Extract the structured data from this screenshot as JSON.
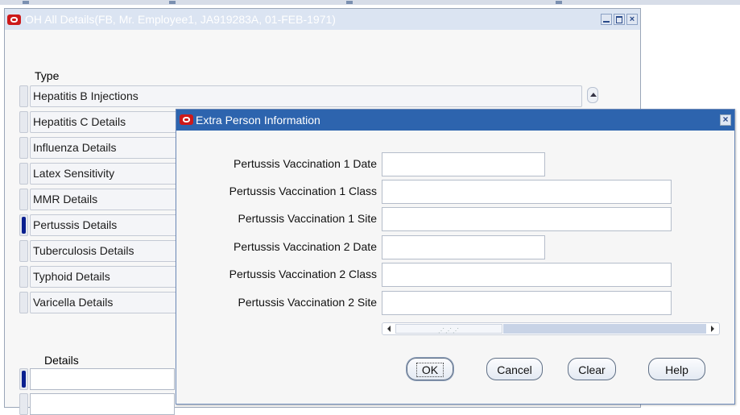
{
  "main_window": {
    "title": "OH All Details(FB, Mr. Employee1, JA919283A, 01-FEB-1971)",
    "type_label": "Type",
    "types": [
      {
        "label": "Hepatitis B Injections",
        "selected": false
      },
      {
        "label": "Hepatitis C Details",
        "selected": false
      },
      {
        "label": "Influenza Details",
        "selected": false
      },
      {
        "label": "Latex Sensitivity",
        "selected": false
      },
      {
        "label": "MMR Details",
        "selected": false
      },
      {
        "label": "Pertussis Details",
        "selected": true
      },
      {
        "label": "Tuberculosis Details",
        "selected": false
      },
      {
        "label": "Typhoid Details",
        "selected": false
      },
      {
        "label": "Varicella Details",
        "selected": false
      }
    ],
    "details_label": "Details"
  },
  "dialog": {
    "title": "Extra Person Information",
    "fields": [
      {
        "label": "Pertussis Vaccination 1 Date",
        "value": ""
      },
      {
        "label": "Pertussis Vaccination 1 Class",
        "value": ""
      },
      {
        "label": "Pertussis Vaccination 1 Site",
        "value": ""
      },
      {
        "label": "Pertussis Vaccination 2 Date",
        "value": ""
      },
      {
        "label": "Pertussis Vaccination 2 Class",
        "value": ""
      },
      {
        "label": "Pertussis Vaccination 2 Site",
        "value": ""
      }
    ],
    "buttons": {
      "ok": {
        "label": "OK"
      },
      "cancel": {
        "label": "Cancel"
      },
      "clear": {
        "label": "Clear"
      },
      "help": {
        "label": "Help"
      }
    }
  },
  "icons": {
    "app_logo": "oracle-logo-icon",
    "minimize": "minimize-icon",
    "maximize": "maximize-icon",
    "close": "close-icon",
    "scroll_up": "scroll-up-arrow-icon",
    "scroll_left": "scroll-left-arrow-icon",
    "scroll_right": "scroll-right-arrow-icon"
  },
  "colors": {
    "dialog_titlebar": "#2d64ae",
    "inactive_titlebar": "#dbe4f2",
    "selection_marker": "#0a1f8f",
    "oracle_red": "#cc1a1a"
  }
}
